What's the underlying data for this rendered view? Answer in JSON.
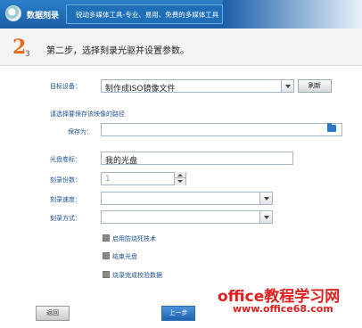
{
  "header": {
    "app_title": "数据刻录",
    "subtitle": "锐动多媒体工具-专业、易用、免费的多媒体工具"
  },
  "step": {
    "big": "2",
    "small": "3",
    "title": "第二步，选择刻录光驱并设置参数。"
  },
  "form": {
    "target_label": "目标设备：",
    "target_value": "制作成ISO镜像文件",
    "refresh_label": "刷新",
    "hint": "请选择要保存该映像的路径",
    "save_label": "保存为：",
    "save_value": "",
    "disc_label_label": "光盘卷标：",
    "disc_label_value": "我的光盘",
    "copies_label": "刻录份数：",
    "copies_value": "1",
    "speed_label": "刻录速度：",
    "speed_value": "",
    "mode_label": "刻录方式：",
    "mode_value": ""
  },
  "options": [
    {
      "label": "启用防烧死技术",
      "checked": false
    },
    {
      "label": "结束光盘",
      "checked": false
    },
    {
      "label": "烧录完成校验数据",
      "checked": false
    }
  ],
  "buttons": {
    "back": "返回",
    "prev": "上一步"
  },
  "watermark": {
    "line1": "office教程学习网",
    "line2": "www.office68.com"
  },
  "colors": {
    "titlebar": "#1a5ea8",
    "step_accent": "#e8691c",
    "label": "#1f4f90",
    "primary_button": "#1f63b0",
    "watermark": "#e0201e"
  }
}
